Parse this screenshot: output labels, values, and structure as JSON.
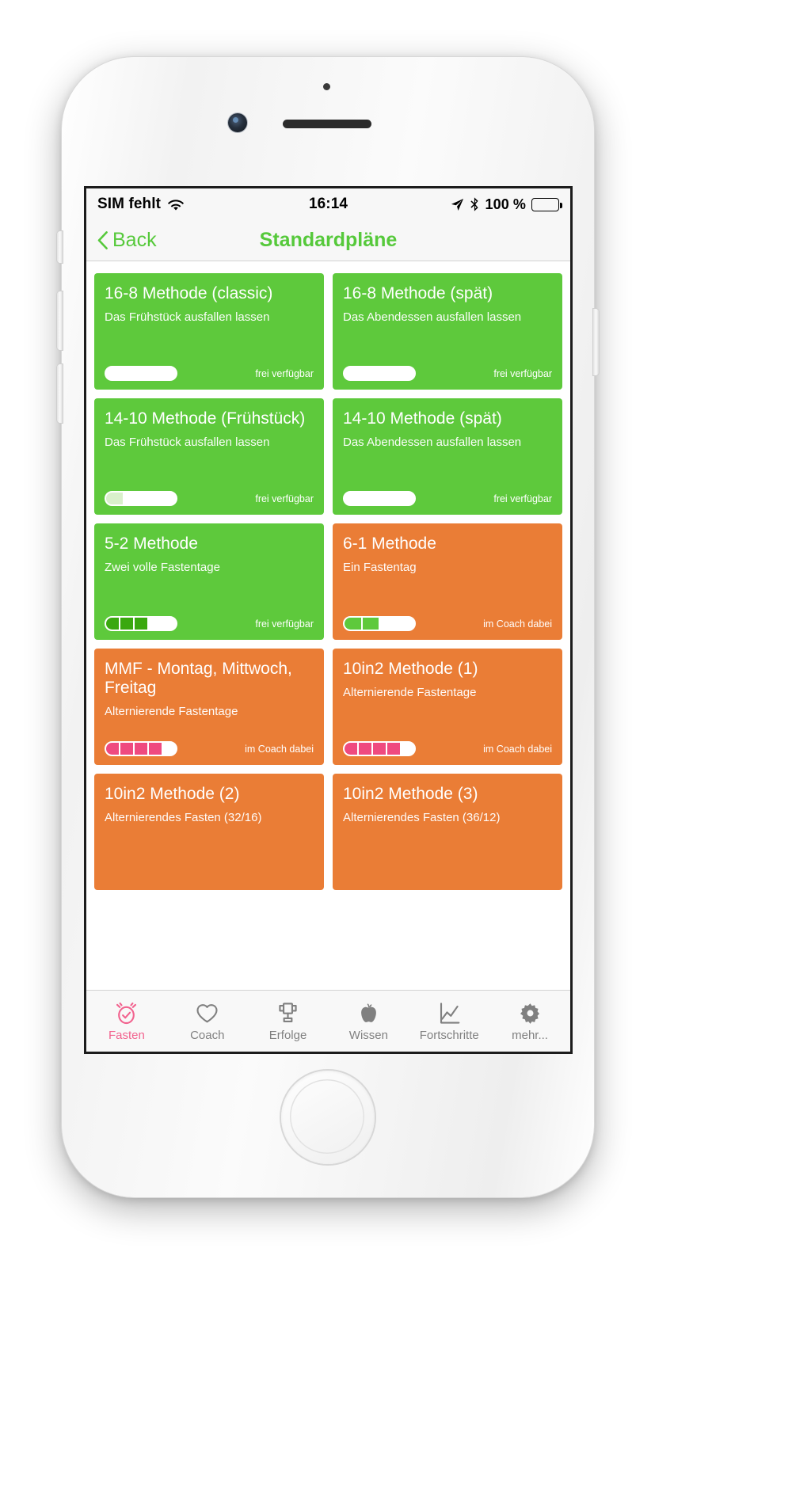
{
  "device": {
    "name": "iphone-white",
    "home_button": "home-button"
  },
  "status_bar": {
    "carrier": "SIM fehlt",
    "wifi_icon": "wifi-icon",
    "time": "16:14",
    "location_icon": "location-arrow-icon",
    "bluetooth_icon": "bluetooth-icon",
    "battery_percent": "100 %",
    "battery_icon": "battery-full-icon"
  },
  "nav_bar": {
    "back_label": "Back",
    "back_icon": "chevron-left-icon",
    "title": "Standardpläne",
    "accent_color": "#56c93b"
  },
  "plans": [
    {
      "title": "16-8 Methode (classic)",
      "subtitle": "Das Frühstück ausfallen lassen",
      "availability": "frei verfügbar",
      "color": "green",
      "segments": [
        "none",
        "none",
        "none",
        "none"
      ],
      "segment_count": 4
    },
    {
      "title": "16-8 Methode (spät)",
      "subtitle": "Das Abendessen ausfallen lassen",
      "availability": "frei verfügbar",
      "color": "green",
      "segments": [
        "none",
        "none",
        "none",
        "none"
      ],
      "segment_count": 4
    },
    {
      "title": "14-10 Methode (Frühstück)",
      "subtitle": "Das Frühstück ausfallen lassen",
      "availability": "frei verfügbar",
      "color": "green",
      "segments": [
        "pale",
        "none",
        "none",
        "none"
      ],
      "segment_count": 4
    },
    {
      "title": "14-10 Methode (spät)",
      "subtitle": "Das Abendessen ausfallen lassen",
      "availability": "frei verfügbar",
      "color": "green",
      "segments": [
        "none",
        "none",
        "none",
        "none"
      ],
      "segment_count": 4
    },
    {
      "title": "5-2 Methode",
      "subtitle": "Zwei volle Fastentage",
      "availability": "frei verfügbar",
      "color": "green",
      "segments": [
        "green",
        "green",
        "green",
        "none",
        "none"
      ],
      "segment_count": 5
    },
    {
      "title": "6-1 Methode",
      "subtitle": "Ein Fastentag",
      "availability": "im Coach dabei",
      "color": "orange",
      "segments": [
        "lgreen",
        "lgreen",
        "none",
        "none"
      ],
      "segment_count": 4
    },
    {
      "title": "MMF - Montag, Mittwoch, Freitag",
      "subtitle": "Alternierende Fastentage",
      "availability": "im Coach dabei",
      "color": "orange",
      "segments": [
        "pink",
        "pink",
        "pink",
        "pink",
        "none"
      ],
      "segment_count": 5
    },
    {
      "title": "10in2 Methode (1)",
      "subtitle": "Alternierende Fastentage",
      "availability": "im Coach dabei",
      "color": "orange",
      "segments": [
        "pink",
        "pink",
        "pink",
        "pink",
        "none"
      ],
      "segment_count": 5
    },
    {
      "title": "10in2 Methode (2)",
      "subtitle": "Alternierendes Fasten (32/16)",
      "availability": "",
      "color": "orange",
      "segments": [],
      "segment_count": 0
    },
    {
      "title": "10in2 Methode (3)",
      "subtitle": "Alternierendes Fasten (36/12)",
      "availability": "",
      "color": "orange",
      "segments": [],
      "segment_count": 0
    }
  ],
  "tab_bar": {
    "active_color": "#f2638f",
    "inactive_color": "#808080",
    "items": [
      {
        "label": "Fasten",
        "icon": "alarm-check-icon",
        "active": true
      },
      {
        "label": "Coach",
        "icon": "heart-icon",
        "active": false
      },
      {
        "label": "Erfolge",
        "icon": "trophy-icon",
        "active": false
      },
      {
        "label": "Wissen",
        "icon": "apple-icon",
        "active": false
      },
      {
        "label": "Fortschritte",
        "icon": "line-chart-icon",
        "active": false
      },
      {
        "label": "mehr...",
        "icon": "gear-icon",
        "active": false
      }
    ]
  },
  "colors": {
    "green_card": "#5ec93c",
    "orange_card": "#ea7d36",
    "accent_green": "#56c93b",
    "accent_pink": "#f2638f"
  }
}
